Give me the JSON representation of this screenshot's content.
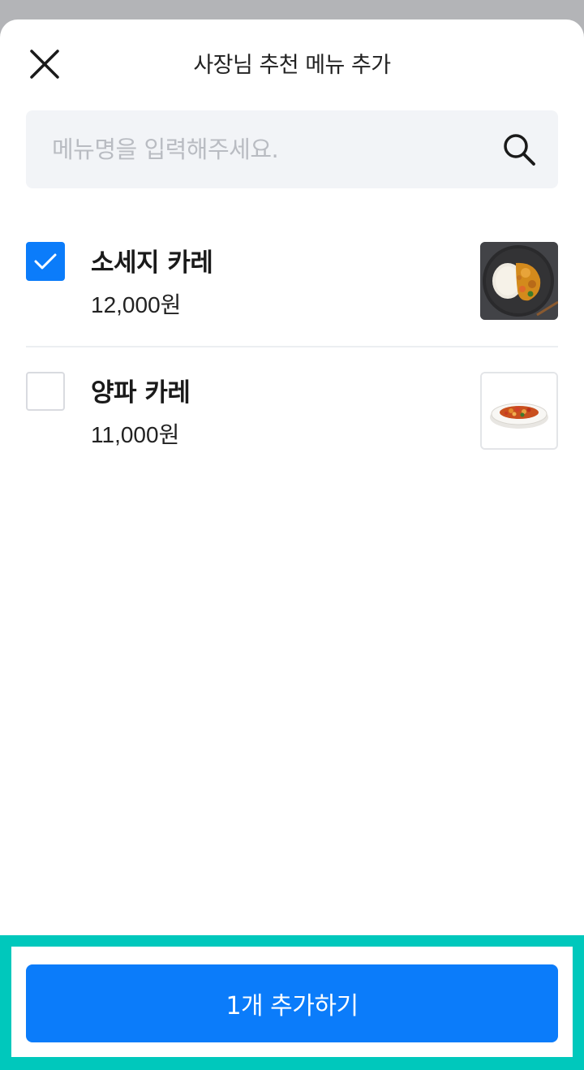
{
  "header": {
    "title": "사장님 추천 메뉴 추가"
  },
  "search": {
    "placeholder": "메뉴명을 입력해주세요.",
    "value": ""
  },
  "menu_items": [
    {
      "name": "소세지 카레",
      "price": "12,000원",
      "checked": true
    },
    {
      "name": "양파 카레",
      "price": "11,000원",
      "checked": false
    }
  ],
  "footer": {
    "submit_label": "1개 추가하기"
  },
  "colors": {
    "accent": "#0b7cfa",
    "highlight": "#00c8bc",
    "backdrop": "#b3b4b7"
  }
}
